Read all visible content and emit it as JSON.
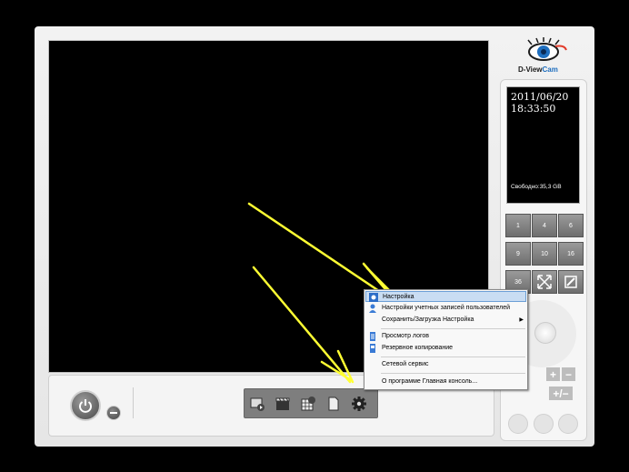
{
  "app": {
    "brand_main": "D-View",
    "brand_accent": "Cam"
  },
  "info_panel": {
    "date": "2011/06/20",
    "time": "18:33:50",
    "free_space": "Свободно:35,3 GB"
  },
  "layout_buttons": [
    "1",
    "4",
    "6",
    "9",
    "10",
    "16",
    "36"
  ],
  "context_menu": {
    "items": [
      {
        "label": "Настройка",
        "highlighted": true
      },
      {
        "label": "Настройки учетных записей пользователей"
      },
      {
        "label": "Сохранить/Загрузка Настройка",
        "has_submenu": true
      },
      {
        "label": "Просмотр логов"
      },
      {
        "label": "Резервное копирование"
      },
      {
        "label": "Сетевой сервис"
      },
      {
        "label": "О программе Главная консоль..."
      }
    ]
  },
  "colors": {
    "annotation_arrow": "#ffff33",
    "menu_highlight": "#c9ddf3",
    "brand_blue": "#1f6fbf"
  }
}
